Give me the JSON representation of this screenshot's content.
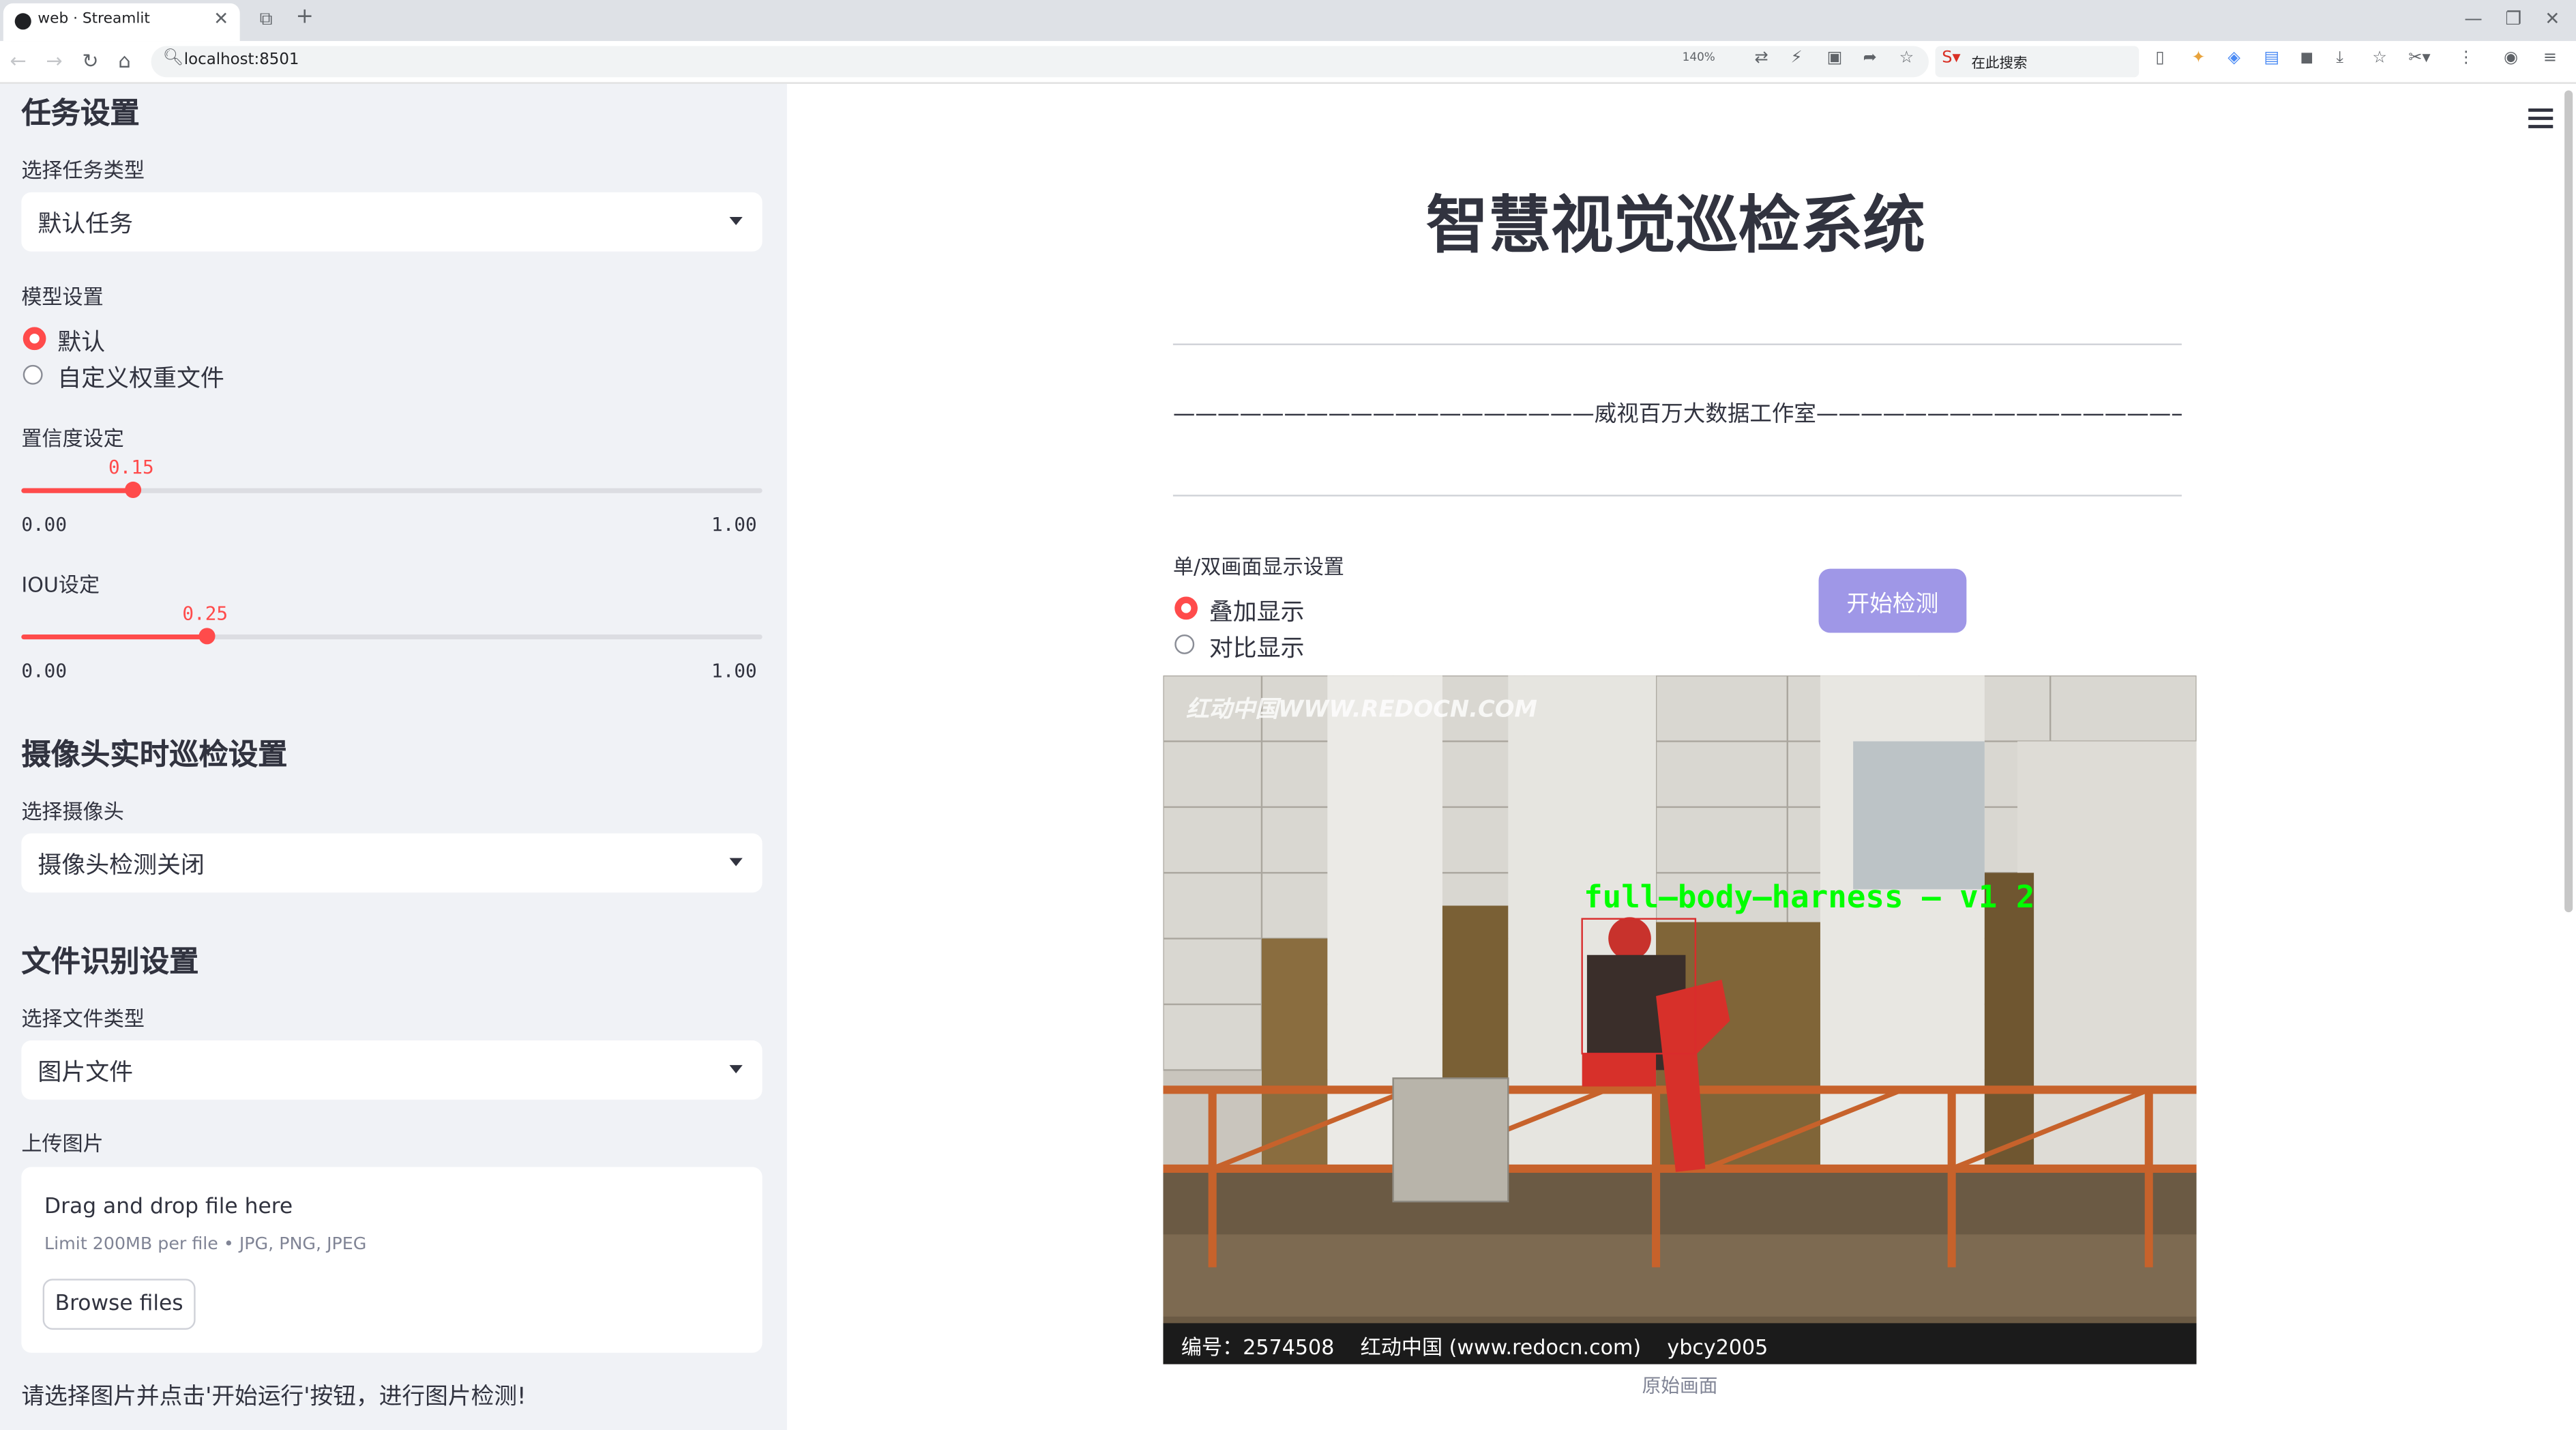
{
  "browser": {
    "tab_title": "web · Streamlit",
    "url": "localhost:8501",
    "zoom": "140%",
    "search_placeholder": "在此搜索"
  },
  "sidebar": {
    "task_header": "任务设置",
    "task_type_label": "选择任务类型",
    "task_type_value": "默认任务",
    "model_label": "模型设置",
    "model_options": [
      "默认",
      "自定义权重文件"
    ],
    "model_selected": "默认",
    "confidence": {
      "label": "置信度设定",
      "value": "0.15",
      "min": "0.00",
      "max": "1.00",
      "fraction": 0.15
    },
    "iou": {
      "label": "IOU设定",
      "value": "0.25",
      "min": "0.00",
      "max": "1.00",
      "fraction": 0.25
    },
    "camera_header": "摄像头实时巡检设置",
    "camera_label": "选择摄像头",
    "camera_value": "摄像头检测关闭",
    "file_header": "文件识别设置",
    "file_type_label": "选择文件类型",
    "file_type_value": "图片文件",
    "upload_label": "上传图片",
    "dropzone_title": "Drag and drop file here",
    "dropzone_hint": "Limit 200MB per file • JPG, PNG, JPEG",
    "browse_label": "Browse files",
    "status_message": "请选择图片并点击'开始运行'按钮，进行图片检测!"
  },
  "main": {
    "title": "智慧视觉巡检系统",
    "subtitle": "———————————————————威视百万大数据工作室————————————————————",
    "display_label": "单/双画面显示设置",
    "display_options": [
      "叠加显示",
      "对比显示"
    ],
    "display_selected": "叠加显示",
    "start_button": "开始检测",
    "image": {
      "watermark_top": "红动中国WWW.REDOCN.COM",
      "detection_label": "full—body—harness — v1 2",
      "watermark_bottom": "编号：2574508    红动中国 (www.redocn.com)    ybcy2005"
    },
    "caption": "原始画面"
  },
  "colors": {
    "accent": "#ff4b4b",
    "start_button": "#9f97e7",
    "detection": "#00ff00",
    "sidebar_bg": "#f0f2f6"
  }
}
